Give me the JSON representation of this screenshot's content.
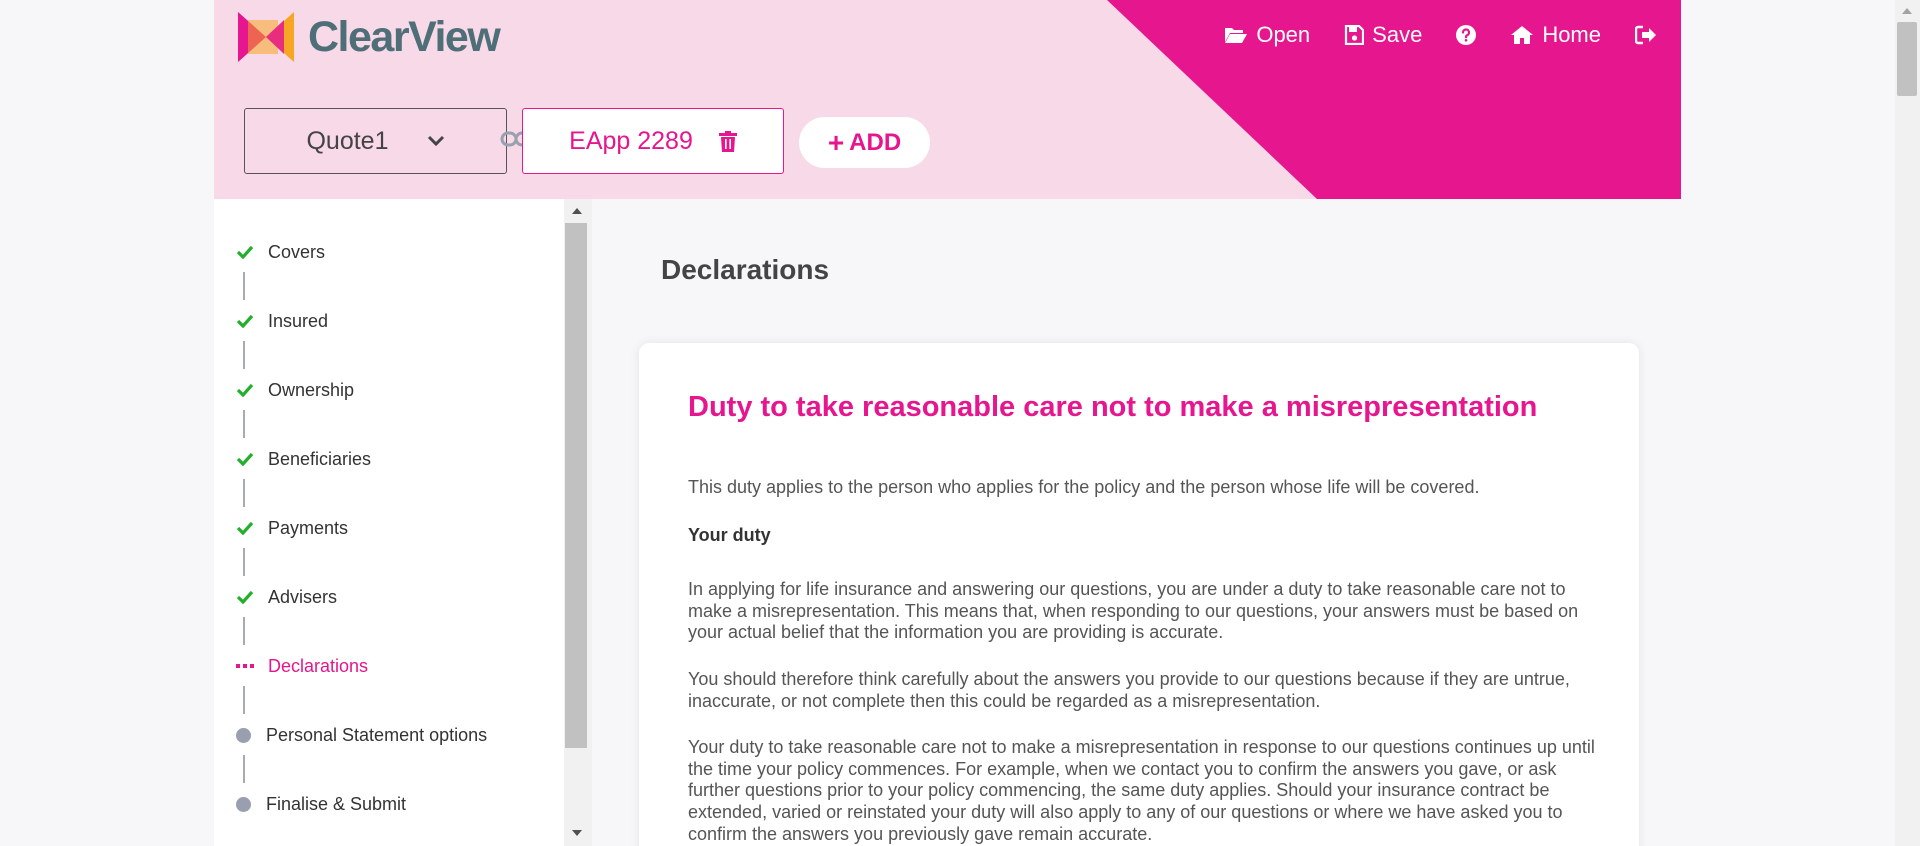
{
  "app": {
    "brand": "ClearView"
  },
  "colors": {
    "primary": "#e5168e",
    "header_bg": "#f8d9e8",
    "logo_text": "#4f6f78",
    "check": "#22b02a",
    "pending_dot": "#999fae"
  },
  "nav": {
    "open_label": "Open",
    "save_label": "Save",
    "home_label": "Home"
  },
  "toolbar": {
    "quote_value": "Quote1",
    "eapp_label": "EApp 2289",
    "add_label": "ADD"
  },
  "sidebar": {
    "steps": [
      {
        "label": "Covers",
        "status": "complete"
      },
      {
        "label": "Insured",
        "status": "complete"
      },
      {
        "label": "Ownership",
        "status": "complete"
      },
      {
        "label": "Beneficiaries",
        "status": "complete"
      },
      {
        "label": "Payments",
        "status": "complete"
      },
      {
        "label": "Advisers",
        "status": "complete"
      },
      {
        "label": "Declarations",
        "status": "active"
      },
      {
        "label": "Personal Statement options",
        "status": "pending"
      },
      {
        "label": "Finalise & Submit",
        "status": "pending"
      }
    ]
  },
  "main": {
    "page_title": "Declarations",
    "card": {
      "title": "Duty to take reasonable care not to make a misrepresentation",
      "intro": "This duty applies to the person who applies for the policy and the person whose life will be covered.",
      "subheading": "Your duty",
      "paragraphs": [
        "In applying for life insurance and answering our questions, you are under a duty to take reasonable care not to make a misrepresentation. This means that, when responding to our questions, your answers must be based on your actual belief that the information you are providing is accurate.",
        "You should therefore think carefully about the answers you provide to our questions because if they are untrue, inaccurate, or not complete then this could be regarded as a misrepresentation.",
        "Your duty to take reasonable care not to make a misrepresentation in response to our questions continues up until the time your policy commences. For example, when we contact you to confirm the answers you gave, or ask further questions prior to your policy commencing, the same duty applies. Should your insurance contract be extended, varied or reinstated your duty will also apply to any of our questions or where we have asked you to confirm the answers you previously gave remain accurate."
      ]
    }
  }
}
